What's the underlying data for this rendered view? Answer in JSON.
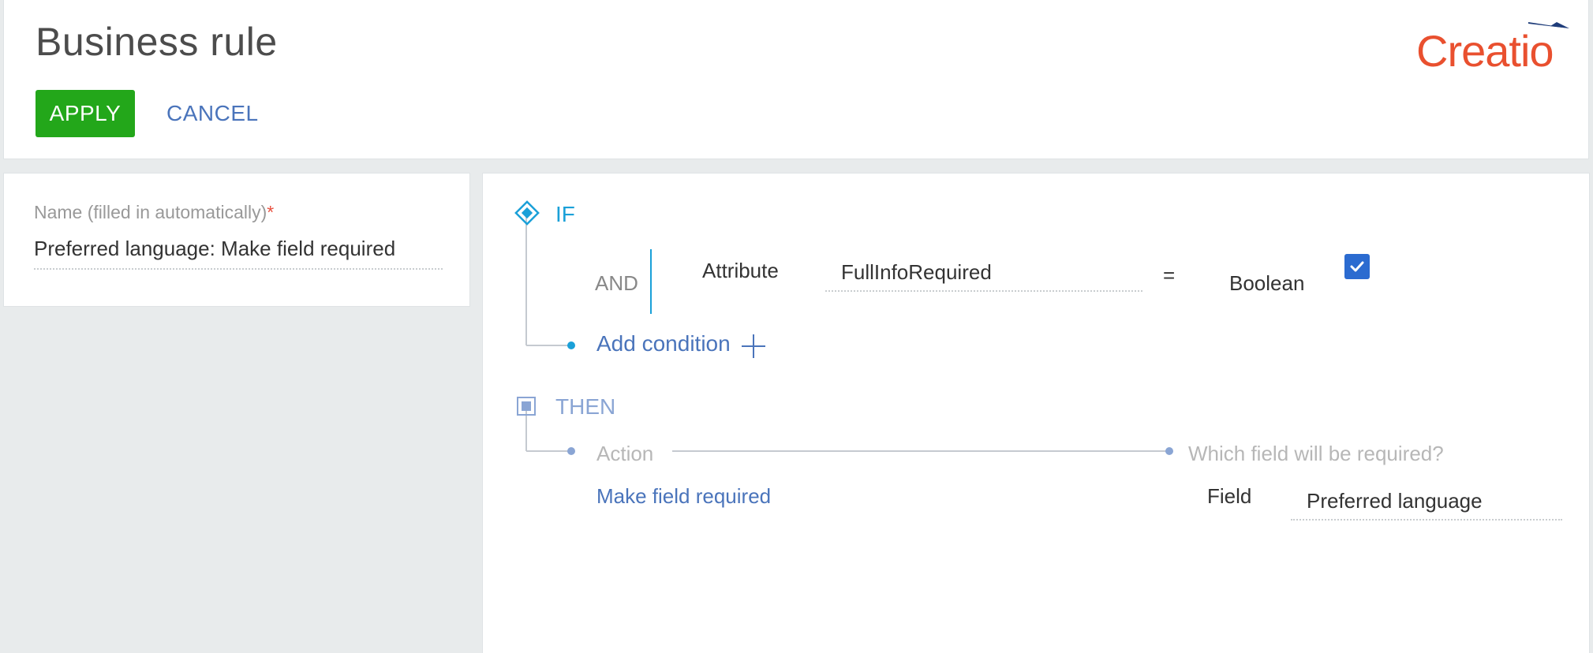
{
  "header": {
    "title": "Business rule",
    "apply_label": "APPLY",
    "cancel_label": "CANCEL",
    "logo_text": "Creatio"
  },
  "name_panel": {
    "label": "Name (filled in automatically)",
    "required_mark": "*",
    "value": "Preferred language: Make field required"
  },
  "rule": {
    "if_label": "IF",
    "condition": {
      "operator": "AND",
      "left_type": "Attribute",
      "left_value": "FullInfoRequired",
      "comparison": "=",
      "right_type": "Boolean",
      "right_checked": true
    },
    "add_condition_label": "Add condition",
    "then_label": "THEN",
    "action_header": "Action",
    "target_header": "Which field will be required?",
    "action_value": "Make field required",
    "field_label": "Field",
    "field_value": "Preferred language"
  },
  "colors": {
    "apply_bg": "#23a71a",
    "link_blue": "#4a74bb",
    "if_blue": "#1aa0d8",
    "logo_orange": "#e9502f",
    "checkbox_blue": "#2b6bd0"
  },
  "icons": {
    "if_node": "diamond-icon",
    "then_node": "square-node-icon",
    "add": "plus-icon",
    "check": "checkmark-icon",
    "logo_mark": "paper-plane-icon"
  }
}
